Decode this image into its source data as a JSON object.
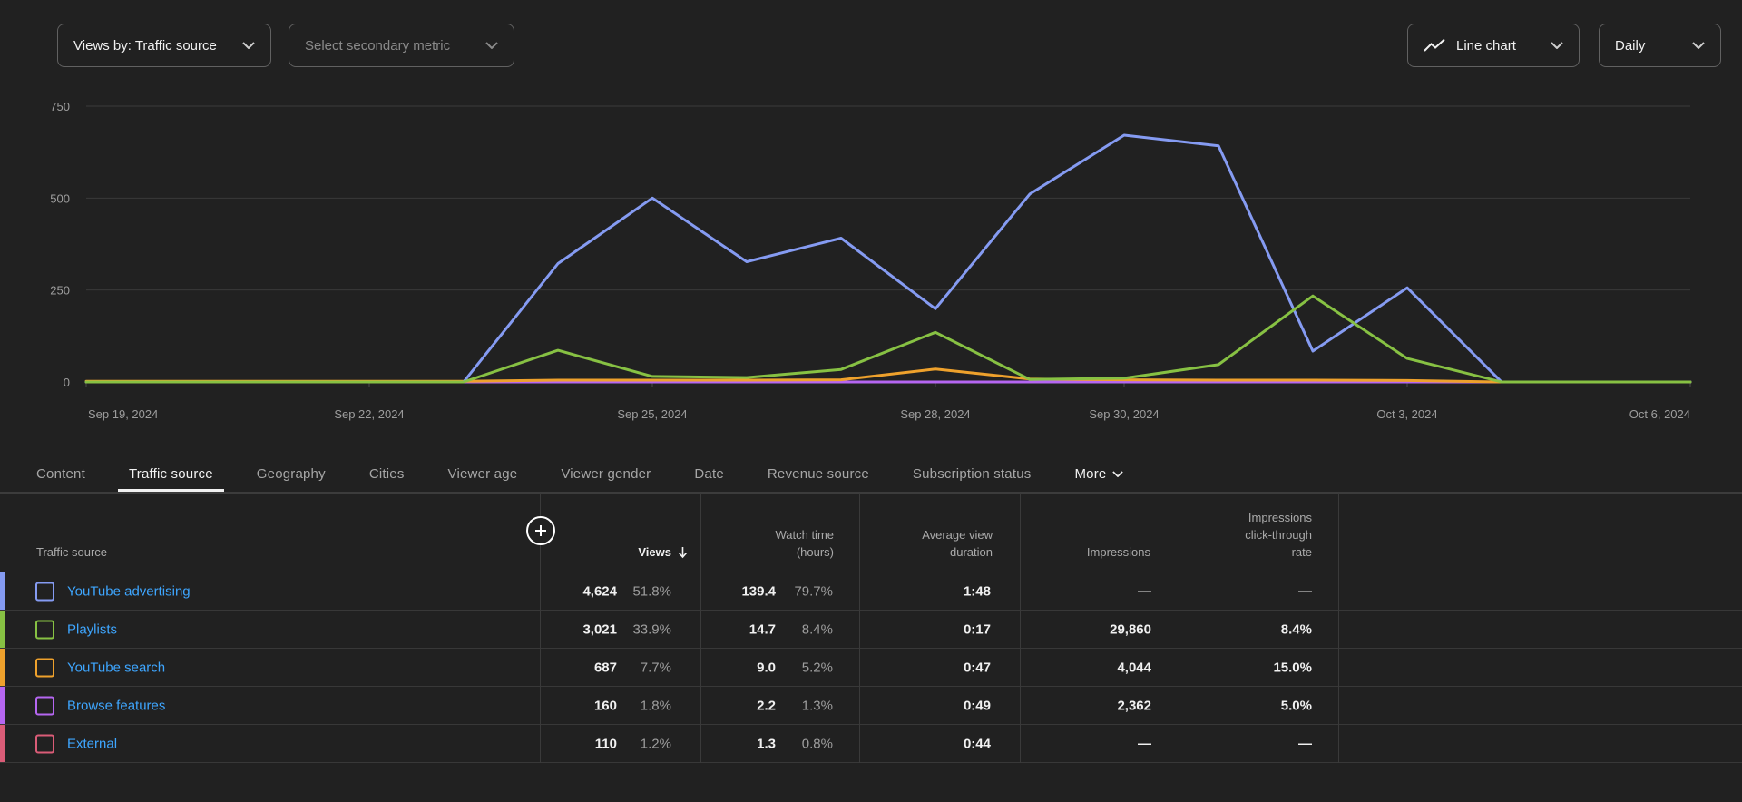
{
  "controls": {
    "primary_metric_label": "Views by: Traffic source",
    "secondary_metric_placeholder": "Select secondary metric",
    "chart_type_label": "Line chart",
    "interval_label": "Daily"
  },
  "chart_data": {
    "type": "line",
    "x": [
      "Sep 19, 2024",
      "Sep 20, 2024",
      "Sep 21, 2024",
      "Sep 22, 2024",
      "Sep 23, 2024",
      "Sep 24, 2024",
      "Sep 25, 2024",
      "Sep 26, 2024",
      "Sep 27, 2024",
      "Sep 28, 2024",
      "Sep 29, 2024",
      "Sep 30, 2024",
      "Oct 1, 2024",
      "Oct 2, 2024",
      "Oct 3, 2024",
      "Oct 4, 2024",
      "Oct 5, 2024",
      "Oct 6, 2024"
    ],
    "x_tick_labels": [
      "Sep 19, 2024",
      "Sep 22, 2024",
      "Sep 25, 2024",
      "Sep 28, 2024",
      "Sep 30, 2024",
      "Oct 3, 2024",
      "Oct 6, 2024"
    ],
    "x_tick_days": [
      0,
      3,
      6,
      9,
      11,
      14,
      17
    ],
    "yticks": [
      0,
      250,
      500,
      750
    ],
    "ylim": [
      0,
      750
    ],
    "grid": true,
    "legend_position": "none",
    "series": [
      {
        "name": "YouTube advertising",
        "color": "#859bf2",
        "values": [
          0,
          0,
          0,
          0,
          0,
          322,
          500,
          327,
          391,
          199,
          511,
          671,
          642,
          84,
          256,
          0,
          0,
          0
        ]
      },
      {
        "name": "Playlists",
        "color": "#87c143",
        "values": [
          0,
          0,
          0,
          0,
          0,
          86,
          15,
          12,
          34,
          135,
          7,
          10,
          47,
          234,
          64,
          0,
          0,
          0
        ]
      },
      {
        "name": "YouTube search",
        "color": "#eea12c",
        "values": [
          2,
          2,
          2,
          2,
          2,
          5,
          5,
          5,
          6,
          35,
          8,
          6,
          5,
          5,
          4,
          0,
          0,
          0
        ]
      },
      {
        "name": "Browse features",
        "color": "#b566f1",
        "values": [
          0,
          0,
          0,
          0,
          0,
          0,
          0,
          0,
          0,
          0,
          0,
          0,
          0,
          0,
          0,
          0,
          0,
          0
        ]
      },
      {
        "name": "External",
        "color": "#da5c77",
        "values": [
          0,
          0,
          0,
          0,
          0,
          0,
          0,
          0,
          0,
          0,
          0,
          0,
          0,
          0,
          0,
          0,
          0,
          0
        ]
      }
    ]
  },
  "tabs": [
    {
      "label": "Content",
      "active": false,
      "chevron": false
    },
    {
      "label": "Traffic source",
      "active": true,
      "chevron": false
    },
    {
      "label": "Geography",
      "active": false,
      "chevron": false
    },
    {
      "label": "Cities",
      "active": false,
      "chevron": false
    },
    {
      "label": "Viewer age",
      "active": false,
      "chevron": false
    },
    {
      "label": "Viewer gender",
      "active": false,
      "chevron": false
    },
    {
      "label": "Date",
      "active": false,
      "chevron": false
    },
    {
      "label": "Revenue source",
      "active": false,
      "chevron": false
    },
    {
      "label": "Subscription status",
      "active": false,
      "chevron": false
    },
    {
      "label": "More",
      "active": false,
      "chevron": true
    }
  ],
  "table": {
    "headers": {
      "source": "Traffic source",
      "views": "Views",
      "watch_time": "Watch time\n(hours)",
      "avg_duration": "Average view\nduration",
      "impressions": "Impressions",
      "ctr": "Impressions\nclick-through\nrate"
    },
    "sort": {
      "column": "Views",
      "direction": "descending"
    },
    "rows": [
      {
        "label": "YouTube advertising",
        "color": "#859bf2",
        "views": "4,624",
        "views_pct": "51.8%",
        "watch": "139.4",
        "watch_pct": "79.7%",
        "duration": "1:48",
        "impressions": "—",
        "ctr": "—"
      },
      {
        "label": "Playlists",
        "color": "#87c143",
        "views": "3,021",
        "views_pct": "33.9%",
        "watch": "14.7",
        "watch_pct": "8.4%",
        "duration": "0:17",
        "impressions": "29,860",
        "ctr": "8.4%"
      },
      {
        "label": "YouTube search",
        "color": "#eea12c",
        "views": "687",
        "views_pct": "7.7%",
        "watch": "9.0",
        "watch_pct": "5.2%",
        "duration": "0:47",
        "impressions": "4,044",
        "ctr": "15.0%"
      },
      {
        "label": "Browse features",
        "color": "#b566f1",
        "views": "160",
        "views_pct": "1.8%",
        "watch": "2.2",
        "watch_pct": "1.3%",
        "duration": "0:49",
        "impressions": "2,362",
        "ctr": "5.0%"
      },
      {
        "label": "External",
        "color": "#da5c77",
        "views": "110",
        "views_pct": "1.2%",
        "watch": "1.3",
        "watch_pct": "0.8%",
        "duration": "0:44",
        "impressions": "—",
        "ctr": "—"
      }
    ]
  },
  "colors": {
    "background": "#212121",
    "gridline": "#3a3a3a",
    "baseline": "#707070",
    "axis_text": "#9e9e9e",
    "divider": "#3a3a3a",
    "link": "#3ea6ff",
    "tab_inactive": "#a6a6a6",
    "text_primary": "#f1f1f1",
    "text_secondary": "#aaaaaa"
  }
}
